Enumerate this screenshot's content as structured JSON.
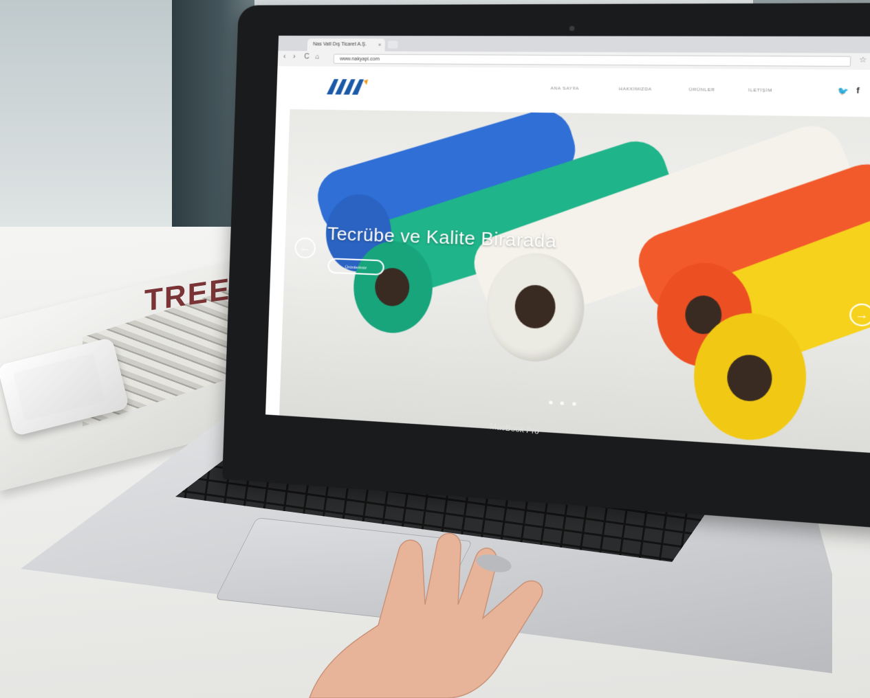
{
  "scene": {
    "magazine_title": "TREE",
    "laptop_label": "MacBook Pro"
  },
  "browser": {
    "tab_title": "Nas Vatl Dış Ticaret A.Ş.",
    "tab_close": "×",
    "url": "www.nakyapi.com",
    "nav": {
      "back": "‹",
      "forward": "›",
      "reload": "C",
      "home": "⌂"
    },
    "toolbar_icons": {
      "star": "☆",
      "ext": "◍",
      "menu": "≡"
    }
  },
  "site": {
    "menu": [
      "ANA SAYFA",
      "HAKKIMIZDA",
      "ÜRÜNLER",
      "İLETİŞİM"
    ],
    "social": {
      "twitter": "🐦",
      "facebook": "f"
    }
  },
  "hero": {
    "title": "Tecrübe ve Kalite Birarada",
    "button": "Ürünlerimiz",
    "prev_arrow": "←",
    "next_arrow": "→",
    "slide_count": 3
  },
  "colors": {
    "blue_roll": "#2f6fd6",
    "green_roll": "#1fb489",
    "white_roll": "#f4f2ea",
    "orange_roll": "#f25a2c",
    "yellow_roll": "#f6d21c",
    "logo": "#1b5aa6"
  }
}
